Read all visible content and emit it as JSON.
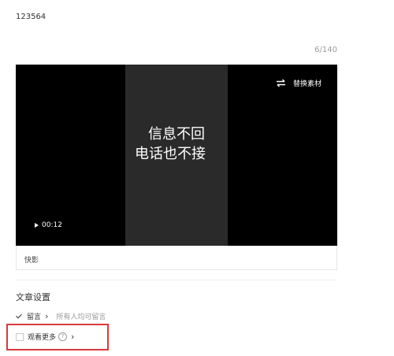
{
  "post": {
    "title": "123564",
    "char_counter": "6/140"
  },
  "video": {
    "caption_line1": "信息不回",
    "caption_line2": "电话也不接",
    "replace_label": "替换素材",
    "duration": "00:12",
    "source_label": "快影"
  },
  "settings": {
    "title": "文章设置",
    "comment": {
      "label": "留言",
      "checked": true,
      "description": "所有人均可留言"
    },
    "see_more": {
      "label": "观看更多",
      "checked": false,
      "help": "?"
    }
  },
  "colors": {
    "highlight": "#d83a3a",
    "video_bg": "#000000",
    "video_center": "#2a2a2a"
  }
}
